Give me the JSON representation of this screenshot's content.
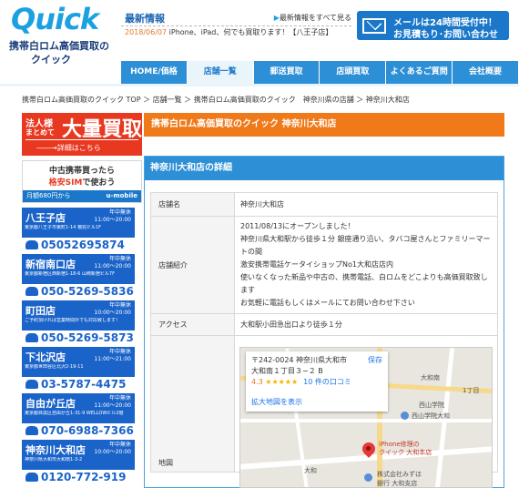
{
  "logo": {
    "word": "Quick",
    "line1": "携帯白ロム高価買取の",
    "line2": "クイック"
  },
  "news": {
    "title": "最新情報",
    "see_all": "最新情報をすべて見る",
    "date": "2018/06/07",
    "text": "iPhone、iPad、何でも買取ります！【八王子店】"
  },
  "mail_button": {
    "line1": "メールは24時間受付中！",
    "line2": "お見積もり･お問い合わせ"
  },
  "nav": {
    "items": [
      {
        "label": "HOME/価格"
      },
      {
        "label": "店舗一覧"
      },
      {
        "label": "郵送買取"
      },
      {
        "label": "店頭買取"
      },
      {
        "label": "よくあるご質問"
      },
      {
        "label": "会社概要"
      }
    ]
  },
  "breadcrumb": "携帯白ロム高価買取のクイック TOP ＞ 店舗一覧 ＞ 携帯白ロム高価買取のクイック　神奈川県の店舗 ＞ 神奈川大和店",
  "sidebar": {
    "bulk": {
      "small1": "法人様",
      "small2": "まとめて",
      "big": "大量買取",
      "link": "詳細はこちら"
    },
    "sim": {
      "line1": "中古携帯買ったら",
      "line2_hl": "格安SIM",
      "line2_rest": "で使おう",
      "foot": "月額680円から",
      "brand": "u-mobile"
    },
    "stores": [
      {
        "name": "八王子店",
        "hours1": "年中無休",
        "hours2": "11:00～20:00",
        "addr": "東京都八王子市東町1-14 橋完ビル1F",
        "phone": "05052695874"
      },
      {
        "name": "新宿南口店",
        "hours1": "年中無休",
        "hours2": "11:00～20:00",
        "addr": "東京都新宿区西新宿1-18-6 山崎新宿ビル7F",
        "phone": "050-5269-5836"
      },
      {
        "name": "町田店",
        "hours1": "年中無休",
        "hours2": "10:00～20:00",
        "addr": "ご予約頂ければ営業時間外でも対応致します！",
        "phone": "050-5269-5873"
      },
      {
        "name": "下北沢店",
        "hours1": "年中無休",
        "hours2": "11:00～21:00",
        "addr": "東京都世田谷区北沢2-19-11",
        "phone": "03-5787-4475"
      },
      {
        "name": "自由が丘店",
        "hours1": "年中無休",
        "hours2": "11:00～20:00",
        "addr": "東京都目黒区自由が丘1-31-9 WELLOWビル2階",
        "phone": "070-6988-7366"
      },
      {
        "name": "神奈川大和店",
        "hours1": "年中無休",
        "hours2": "10:00～20:00",
        "addr": "神奈川県大和市大和南1-3-2",
        "phone": "0120-772-919"
      }
    ]
  },
  "main": {
    "title": "携帯白ロム高価買取のクイック 神奈川大和店",
    "detail_title": "神奈川大和店の詳細",
    "rows": {
      "store_label": "店舗名",
      "store_value": "神奈川大和店",
      "intro_label": "店舗紹介",
      "intro_lines": [
        "2011/08/13にオープンしました！",
        "神奈川県大和駅から徒歩１分 銀座通り沿い、タバコ屋さんとファミリーマートの間",
        "激安携帯電話ケータイショップNo1大和店店内",
        "使いなくなった新品や中古の、携帯電話、白ロムをどこよりも高価買取致します",
        "お気軽に電話もしくはメールにてお問い合わせ下さい"
      ],
      "access_label": "アクセス",
      "access_value": "大和駅小田急出口より徒歩１分",
      "map_label": "地図"
    },
    "map": {
      "address1": "〒242-0024 神奈川県大和市",
      "address2": "大和南１丁目３−２ B",
      "save": "保存",
      "rating": "4.3",
      "stars": "★★★★★",
      "reviews": "10 件の口コミ",
      "bigger": "拡大地図を表示",
      "pin_label1": "iPhone修理の",
      "pin_label2": "クイック 大和本店",
      "poi1": "株式会社みずほ",
      "poi2": "銀行 大和支店",
      "poi3": "西山学院大和",
      "poi4": "大和南",
      "poi5": "大和",
      "poi6": "1丁目",
      "poi7": "西山学院"
    }
  }
}
